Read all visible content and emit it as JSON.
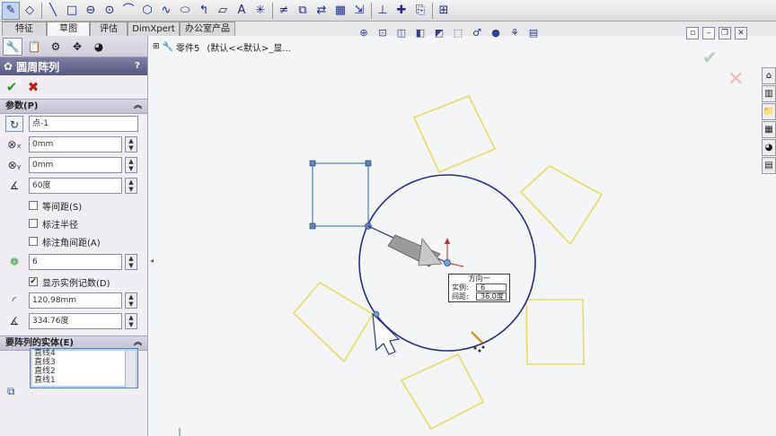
{
  "tabs": [
    {
      "label": "特征"
    },
    {
      "label": "草图"
    },
    {
      "label": "评估"
    },
    {
      "label": "DimXpert"
    },
    {
      "label": "办公室产品"
    }
  ],
  "toolbar": {
    "icons": [
      "sketch-icon",
      "smart-dimension-icon",
      "line-icon",
      "rectangle-icon",
      "slot-icon",
      "circle-icon",
      "arc-icon",
      "polygon-icon",
      "spline-icon",
      "ellipse-icon",
      "fillet-icon",
      "plane-icon",
      "text-icon",
      "point-icon",
      "trim-icon",
      "offset-icon",
      "mirror-icon",
      "linear-pattern-icon",
      "move-icon",
      "relations-icon",
      "repair-icon",
      "rapid-sketch-icon",
      "instant2d-icon"
    ]
  },
  "property_manager": {
    "title": "圆周阵列",
    "help": "?",
    "ok_icon": "✔",
    "cancel_icon": "✖",
    "params_header": "参数(P)",
    "center_point": "点-1",
    "x_coord": "0mm",
    "y_coord": "0mm",
    "angle": "60度",
    "equal_spacing": "等间距(S)",
    "dim_radius": "标注半径",
    "dim_angle_spacing": "标注角间距(A)",
    "instances": "6",
    "show_instance_count": "显示实例记数(D)",
    "radius": "120.98mm",
    "arc_angle": "334.76度",
    "entities_header": "要阵列的实体(E)",
    "entities": [
      "直线4",
      "直线3",
      "直线2",
      "直线1"
    ]
  },
  "tree_flyout": {
    "part": "零件5",
    "config": "(默认<<默认>_显..."
  },
  "direction_tip": {
    "title": "方向一",
    "instances_label": "实例:",
    "instances_value": "6",
    "spacing_label": "间距:",
    "spacing_value": "36.0度"
  },
  "colors": {
    "pattern_preview": "#e8dd6a",
    "circle": "#2b2b8f",
    "selected_square": "#4a7fc0",
    "panel_title": "#61618d"
  }
}
